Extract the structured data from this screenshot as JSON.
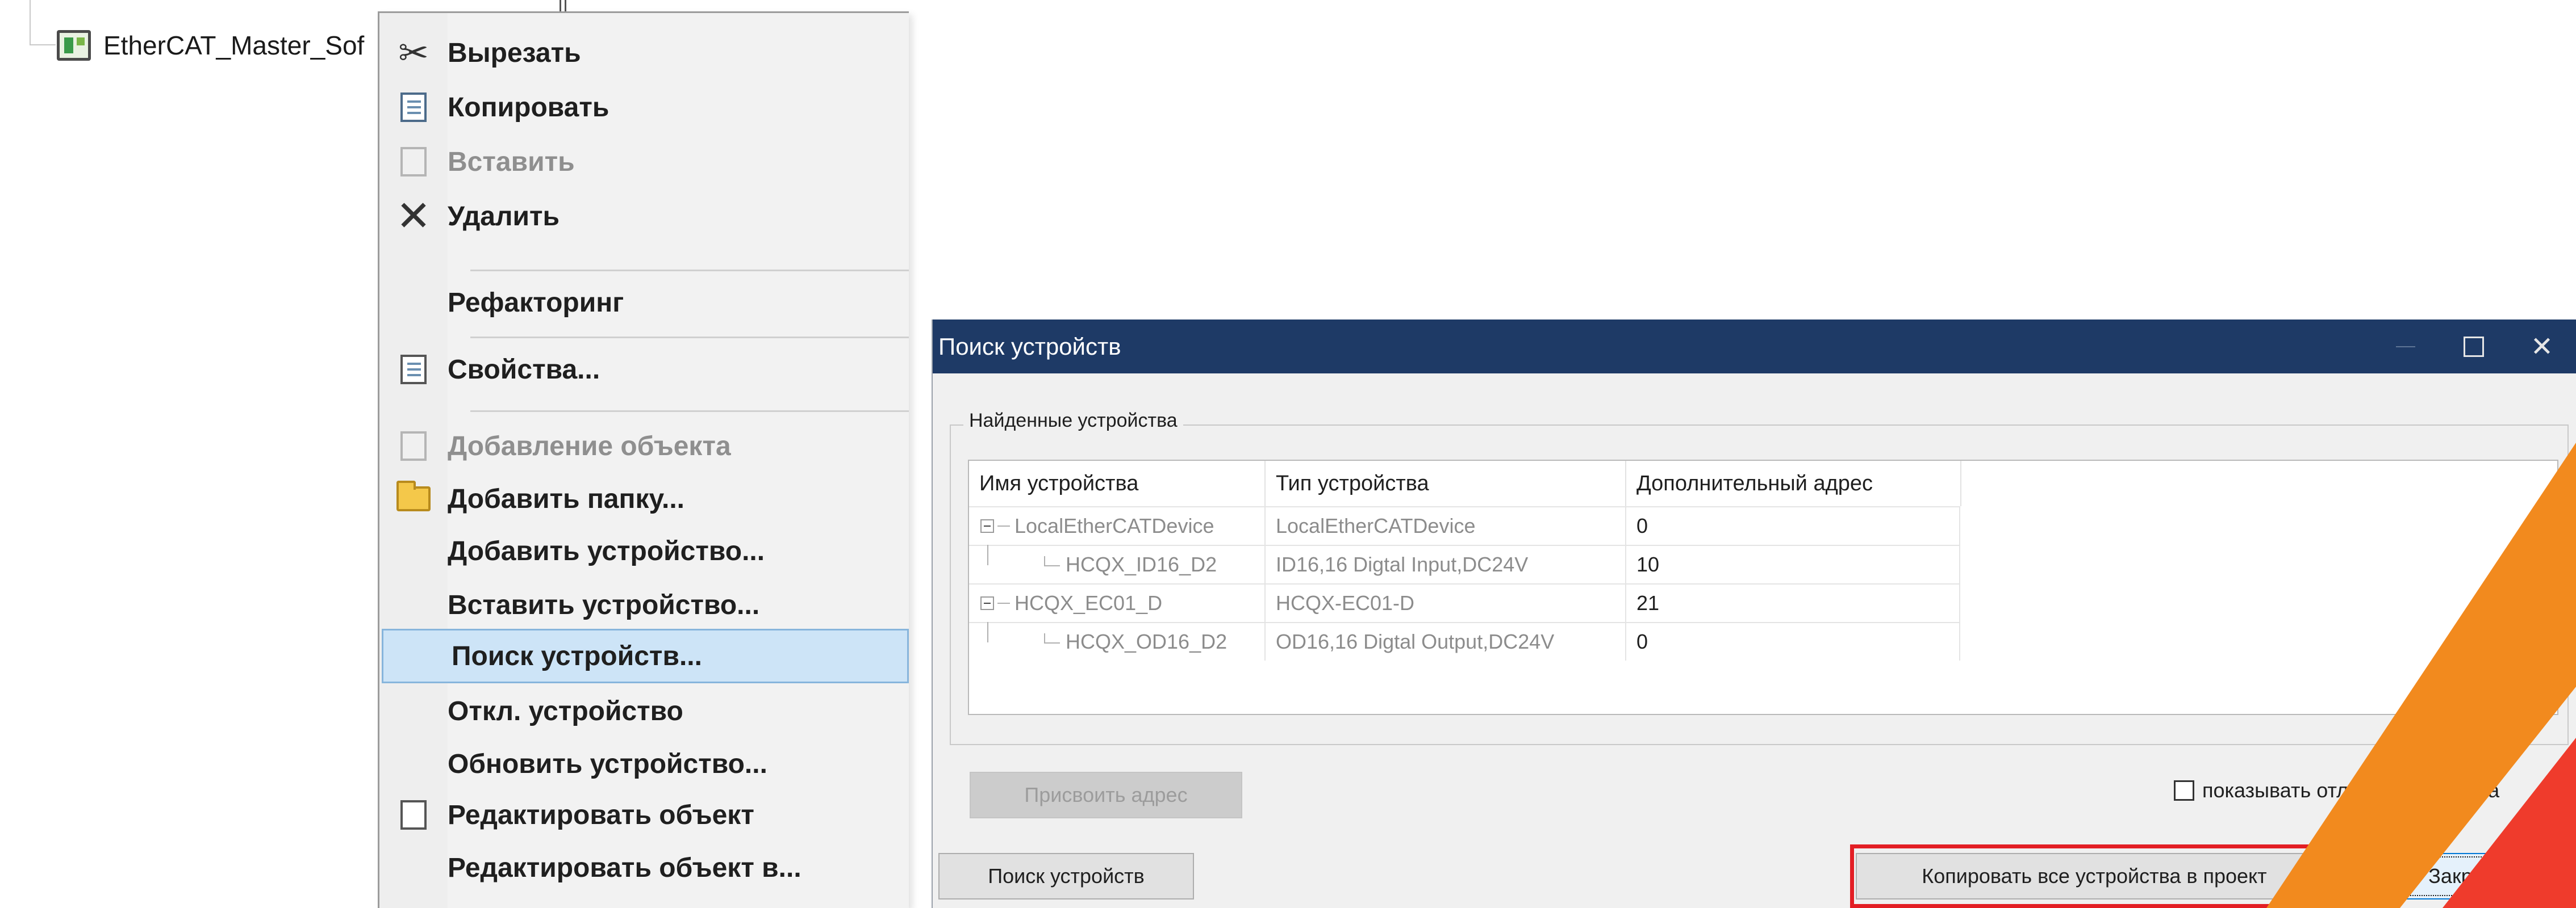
{
  "tree": {
    "item_label": "EtherCAT_Master_Sof"
  },
  "context_menu": {
    "items": [
      {
        "label": "Вырезать",
        "icon": "scissors-icon",
        "disabled": false
      },
      {
        "label": "Копировать",
        "icon": "copy-icon",
        "disabled": false
      },
      {
        "label": "Вставить",
        "icon": "paste-icon",
        "disabled": true
      },
      {
        "label": "Удалить",
        "icon": "delete-icon",
        "disabled": false
      },
      {
        "label": "Рефакторинг",
        "icon": "",
        "disabled": false
      },
      {
        "label": "Свойства...",
        "icon": "properties-icon",
        "disabled": false
      },
      {
        "label": "Добавление объекта",
        "icon": "add-object-icon",
        "disabled": true
      },
      {
        "label": "Добавить папку...",
        "icon": "folder-icon",
        "disabled": false
      },
      {
        "label": "Добавить устройство...",
        "icon": "",
        "disabled": false
      },
      {
        "label": "Вставить устройство...",
        "icon": "",
        "disabled": false
      },
      {
        "label": "Поиск устройств...",
        "icon": "",
        "disabled": false,
        "highlighted": true
      },
      {
        "label": "Откл. устройство",
        "icon": "",
        "disabled": false
      },
      {
        "label": "Обновить устройство...",
        "icon": "",
        "disabled": false
      },
      {
        "label": "Редактировать объект",
        "icon": "edit-object-icon",
        "disabled": false
      },
      {
        "label": "Редактировать объект в...",
        "icon": "",
        "disabled": false
      }
    ]
  },
  "dialog": {
    "title": "Поиск устройств",
    "group_title": "Найденные устройства",
    "table": {
      "columns": [
        "Имя устройства",
        "Тип устройства",
        "Дополнительный адрес"
      ],
      "rows": [
        {
          "name": "LocalEtherCATDevice",
          "type": "LocalEtherCATDevice",
          "address": "0",
          "level": 0
        },
        {
          "name": "HCQX_ID16_D2",
          "type": "ID16,16 Digtal Input,DC24V",
          "address": "10",
          "level": 1
        },
        {
          "name": "HCQX_EC01_D",
          "type": "HCQX-EC01-D",
          "address": "21",
          "level": 0
        },
        {
          "name": "HCQX_OD16_D2",
          "type": "OD16,16 Digtal Output,DC24V",
          "address": "0",
          "level": 1
        }
      ]
    },
    "assign_button": "Присвоить адрес",
    "show_diff_label": "показывать отличия от проекта",
    "show_diff_checked": false,
    "scan_button": "Поиск устройств",
    "copy_all_button": "Копировать все устройства в проект",
    "close_button": "Закрыть"
  },
  "colors": {
    "titlebar": "#1e3a66",
    "menu_highlight": "#cde4f7",
    "annotation_red": "#e31e24",
    "logo_orange": "#f28a1e"
  }
}
